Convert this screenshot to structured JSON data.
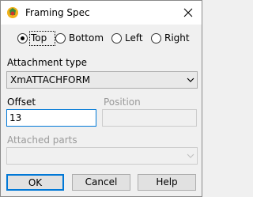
{
  "window": {
    "title": "Framing Spec",
    "close_glyph": "close-icon"
  },
  "position_radio": {
    "options": [
      "Top",
      "Bottom",
      "Left",
      "Right"
    ],
    "selected": "Top"
  },
  "attachment_type": {
    "label": "Attachment type",
    "value": "XmATTACHFORM"
  },
  "offset": {
    "label": "Offset",
    "value": "13"
  },
  "position": {
    "label": "Position",
    "value": ""
  },
  "attached_parts": {
    "label": "Attached parts",
    "value": ""
  },
  "buttons": {
    "ok": "OK",
    "cancel": "Cancel",
    "help": "Help"
  },
  "colors": {
    "accent": "#0078d7",
    "disabled_text": "#9a9a9a"
  }
}
